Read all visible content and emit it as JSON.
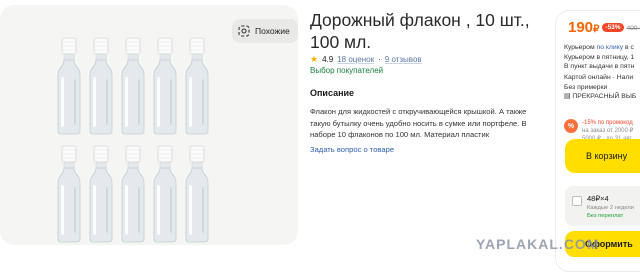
{
  "gallery": {
    "similar_label": "Похожие",
    "similar_icon": "camera-search-icon",
    "rows": [
      5,
      5
    ]
  },
  "product": {
    "title": "Дорожный флакон , 10 шт., 100 мл.",
    "rating": "4.9",
    "reviews_count": "18 оценок",
    "separator": "·",
    "reviews": "9 отзывов",
    "badge": "Выбор покупателей",
    "description_title": "Описание",
    "description": "Флакон для жидкостей с откручивающейся крышкой. А также такую бутылку очень удобно носить в сумке или портфеле. В наборе 10 флаконов по 100 мл. Материал пластик",
    "ask_link": "Задать вопрос о товаре"
  },
  "purchase": {
    "price": "190",
    "currency": "₽",
    "discount": "-53%",
    "old_price": "400 ₽",
    "delivery_1_prefix": "Курьером ",
    "delivery_1_link": "по клику",
    "delivery_1_suffix": " в с",
    "delivery_2": "Курьером в пятницу, 1",
    "delivery_3": "В пункт выдачи в пятн",
    "payment_1": "Картой онлайн · Нали",
    "payment_2": "Без примерки",
    "payment_3": "ПРЕКРАСНЫЙ ВЫБ",
    "promo_title": "-15% по промокод",
    "promo_sub_1": "на заказ от 2000 ₽",
    "promo_sub_2": "5000 ₽ · до 31 авг",
    "promo_icon_label": "%",
    "cart_label": "В корзину",
    "split_price": "48₽×4",
    "split_sub": "Каждые 2 недели",
    "split_sub2": "Без переплат",
    "order_label": "Оформить"
  },
  "watermark": "YAPLAKAL.COM",
  "colors": {
    "accent": "#ffde00",
    "price": "#f76500",
    "discount": "#f2462a",
    "link": "#2d5fb0",
    "badge_green": "#197f3e"
  }
}
